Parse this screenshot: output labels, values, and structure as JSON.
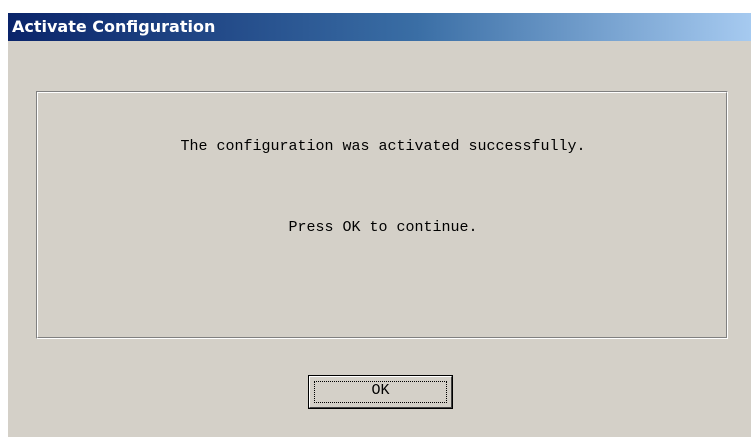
{
  "window": {
    "title": "Activate Configuration"
  },
  "message": {
    "line1": "The configuration was activated successfully.",
    "line2": "Press OK to continue."
  },
  "buttons": {
    "ok_label": "OK"
  },
  "colors": {
    "titlebar_start": "#0a246a",
    "titlebar_end": "#a6caf0",
    "dialog_background": "#d4d0c8",
    "title_text": "#ffffff"
  }
}
